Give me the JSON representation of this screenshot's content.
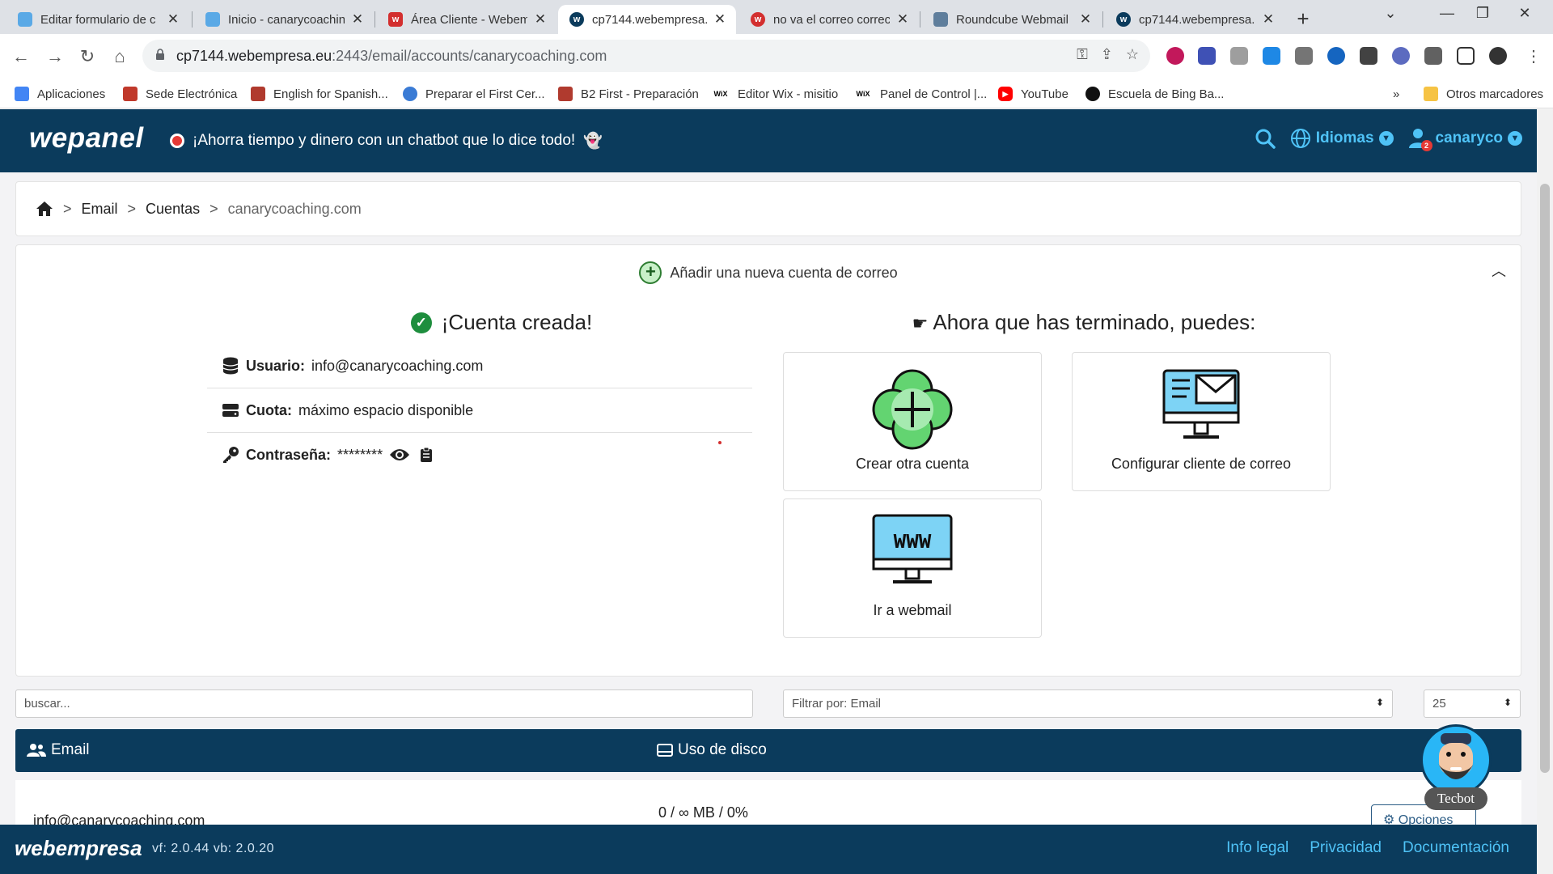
{
  "browser": {
    "tabs": [
      {
        "label": "Editar formulario de c",
        "favicon_color": "#5aa9e6",
        "active": false
      },
      {
        "label": "Inicio - canarycoachin",
        "favicon_color": "#5aa9e6",
        "active": false
      },
      {
        "label": "Área Cliente - Webem",
        "favicon_color": "#d32f2f",
        "active": false
      },
      {
        "label": "cp7144.webempresa.e",
        "favicon_color": "#0b3b5c",
        "active": true
      },
      {
        "label": "no va el correo correc",
        "favicon_color": "#d32f2f",
        "active": false
      },
      {
        "label": "Roundcube Webmail",
        "favicon_color": "#5f7e9c",
        "active": false
      },
      {
        "label": "cp7144.webempresa.e",
        "favicon_color": "#0b3b5c",
        "active": false
      }
    ],
    "url_host": "cp7144.webempresa.eu",
    "url_path": ":2443/email/accounts/canarycoaching.com",
    "bookmarks": [
      {
        "label": "Aplicaciones",
        "color": "#4285f4"
      },
      {
        "label": "Sede Electrónica",
        "color": "#c0392b"
      },
      {
        "label": "English for Spanish...",
        "color": "#b03a2e"
      },
      {
        "label": "Preparar el First Cer...",
        "color": "#3a7bd5"
      },
      {
        "label": "B2 First - Preparación",
        "color": "#b03a2e"
      },
      {
        "label": "Editor Wix - misitio",
        "color": "#000000"
      },
      {
        "label": "Panel de Control |...",
        "color": "#000000"
      },
      {
        "label": "YouTube",
        "color": "#ff0000"
      },
      {
        "label": "Escuela de Bing Ba...",
        "color": "#111111"
      }
    ],
    "more_bookmarks": "»",
    "other_bookmarks": "Otros marcadores"
  },
  "header": {
    "logo": "wepanel",
    "promo": "¡Ahorra tiempo y dinero con un chatbot que lo dice todo!",
    "languages": "Idiomas",
    "user": "canaryco",
    "notif_count": "2"
  },
  "breadcrumb": {
    "email": "Email",
    "accounts": "Cuentas",
    "current": "canarycoaching.com"
  },
  "add_account": {
    "title": "Añadir una nueva cuenta de correo"
  },
  "created": {
    "title": "¡Cuenta creada!",
    "user_label": "Usuario:",
    "user_value": "info@canarycoaching.com",
    "quota_label": "Cuota:",
    "quota_value": "máximo espacio disponible",
    "password_label": "Contraseña:",
    "password_value": "********"
  },
  "next_steps": {
    "title": "Ahora que has terminado, puedes:",
    "create_another": "Crear otra cuenta",
    "configure_client": "Configurar cliente de correo",
    "webmail": "Ir a webmail",
    "webmail_icon_text": "WWW"
  },
  "filters": {
    "search_placeholder": "buscar...",
    "filter_by": "Filtrar por: Email",
    "per_page": "25"
  },
  "table": {
    "col_email": "Email",
    "col_disk": "Uso de disco",
    "rows": [
      {
        "email": "info@canarycoaching.com",
        "usage": "0 / ∞ MB / 0%",
        "options": "Opciones"
      }
    ]
  },
  "chatbot": {
    "name": "Tecbot"
  },
  "footer": {
    "logo": "webempresa",
    "version": "vf: 2.0.44 vb: 2.0.20",
    "legal": "Info legal",
    "privacy": "Privacidad",
    "docs": "Documentación"
  }
}
